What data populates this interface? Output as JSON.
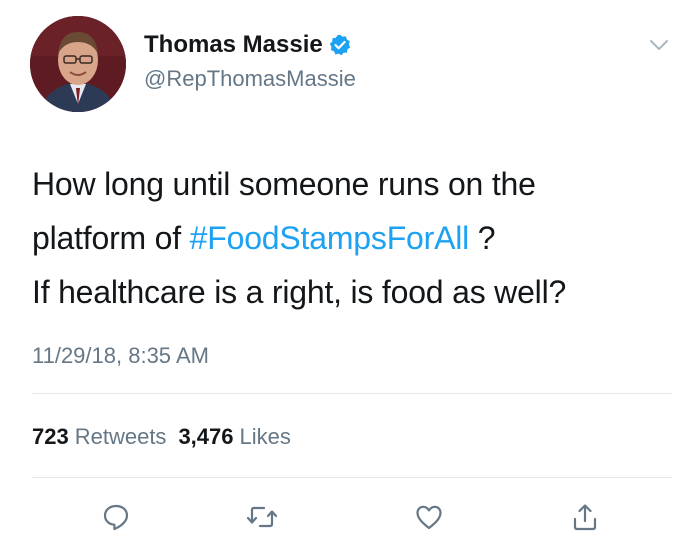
{
  "tweet": {
    "author": {
      "display_name": "Thomas Massie",
      "handle": "@RepThomasMassie",
      "verified": true,
      "verified_icon": "verified-badge-icon"
    },
    "body": {
      "line1": "How long until someone runs on the",
      "line2_prefix": "platform of ",
      "hashtag": "#FoodStampsForAll",
      "line2_suffix": " ?",
      "line3": "If healthcare is a right, is food as well?"
    },
    "timestamp": "11/29/18, 8:35 AM",
    "stats": {
      "retweets_count": "723",
      "retweets_label": "Retweets",
      "likes_count": "3,476",
      "likes_label": "Likes"
    },
    "actions": {
      "reply_icon": "reply-icon",
      "retweet_icon": "retweet-icon",
      "like_icon": "heart-icon",
      "share_icon": "share-icon"
    },
    "menu_icon": "chevron-down-icon"
  },
  "colors": {
    "text": "#14171a",
    "secondary_text": "#657786",
    "accent": "#1da1f2",
    "divider": "#e1e8ed"
  }
}
